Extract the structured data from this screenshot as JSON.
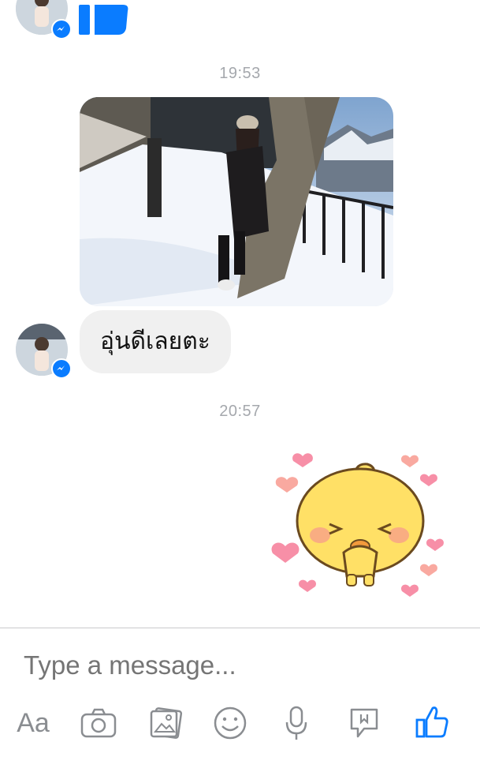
{
  "thread": {
    "timestamps": [
      "19:53",
      "20:57"
    ],
    "incoming_message": "อุ่นดีเลยตะ"
  },
  "composer": {
    "placeholder": "Type a message...",
    "aa_label": "Aa",
    "tools": [
      "text-size-icon",
      "camera-icon",
      "gallery-icon",
      "emoji-icon",
      "microphone-icon",
      "sticker-icon",
      "like-icon"
    ]
  },
  "colors": {
    "accent": "#0a7cff",
    "bubble_bg": "#f0f0f0",
    "muted_text": "#a5a8ad",
    "icon_gray": "#8a8d91"
  }
}
